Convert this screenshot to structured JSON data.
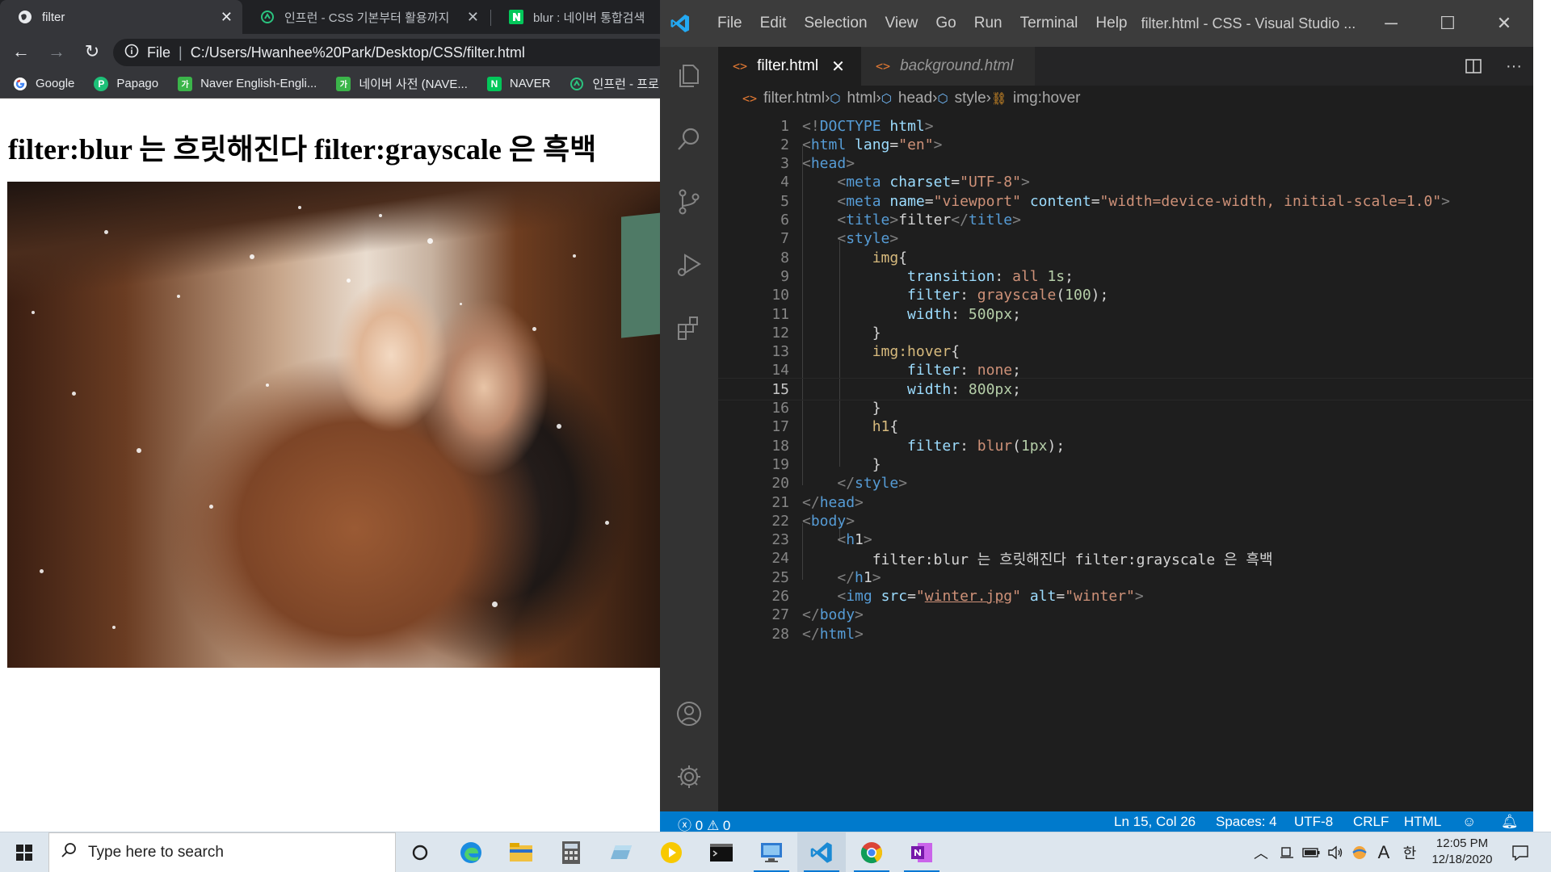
{
  "browser": {
    "tabs": [
      {
        "title": "filter",
        "active": true
      },
      {
        "title": "인프런 - CSS 기본부터 활용까지",
        "active": false
      },
      {
        "title": "blur : 네이버 통합검색",
        "active": false
      }
    ],
    "address": {
      "scheme": "File",
      "path": "C:/Users/Hwanhee%20Park/Desktop/CSS/filter.html"
    },
    "bookmarks": [
      {
        "label": "Google",
        "icon": "google-icon"
      },
      {
        "label": "Papago",
        "icon": "papago-icon"
      },
      {
        "label": "Naver English-Engli...",
        "icon": "naver-dict-icon"
      },
      {
        "label": "네이버 사전 (NAVE...",
        "icon": "naver-dict-icon"
      },
      {
        "label": "NAVER",
        "icon": "naver-icon"
      },
      {
        "label": "인프런 - 프로",
        "icon": "inflearn-icon"
      }
    ],
    "page": {
      "heading": "filter:blur 는 흐릿해진다 filter:grayscale 은 흑백",
      "image_alt": "winter"
    }
  },
  "vscode": {
    "menu": [
      "File",
      "Edit",
      "Selection",
      "View",
      "Go",
      "Run",
      "Terminal",
      "Help"
    ],
    "window_title": "filter.html - CSS - Visual Studio ...",
    "tabs": [
      {
        "label": "filter.html",
        "active": true
      },
      {
        "label": "background.html",
        "active": false
      }
    ],
    "breadcrumb": [
      "filter.html",
      "html",
      "head",
      "style",
      "img:hover"
    ],
    "current_line": 15,
    "code_lines": [
      "<!DOCTYPE html>",
      "<html lang=\"en\">",
      "<head>",
      "    <meta charset=\"UTF-8\">",
      "    <meta name=\"viewport\" content=\"width=device-width, initial-scale=1.0\">",
      "    <title>filter</title>",
      "    <style>",
      "        img{",
      "            transition: all 1s;",
      "            filter: grayscale(100);",
      "            width: 500px;",
      "        }",
      "        img:hover{",
      "            filter: none;",
      "            width: 800px;",
      "        }",
      "        h1{",
      "            filter: blur(1px);",
      "        }",
      "    </style>",
      "</head>",
      "<body>",
      "    <h1>",
      "        filter:blur 는 흐릿해진다 filter:grayscale 은 흑백",
      "    </h1>",
      "    <img src=\"winter.jpg\" alt=\"winter\">",
      "</body>",
      "</html>"
    ],
    "status": {
      "errors": "0",
      "warnings": "0",
      "cursor": "Ln 15, Col 26",
      "spaces": "Spaces: 4",
      "encoding": "UTF-8",
      "eol": "CRLF",
      "language": "HTML"
    }
  },
  "taskbar": {
    "search_placeholder": "Type here to search",
    "ime": "A",
    "ime_lang": "한",
    "time": "12:05 PM",
    "date": "12/18/2020"
  },
  "colors": {
    "vscode_accent": "#007acc",
    "editor_bg": "#1e1e1e",
    "chrome_dark": "#202124"
  }
}
